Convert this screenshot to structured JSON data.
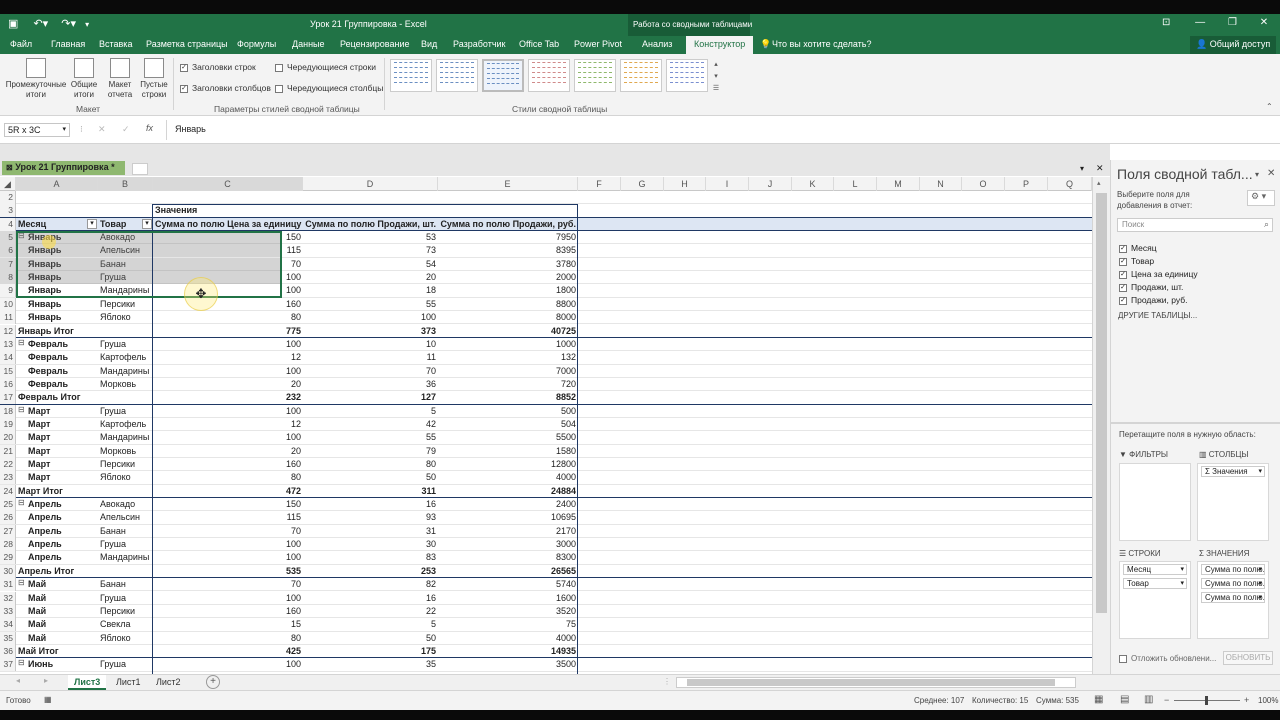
{
  "window": {
    "title": "Урок 21 Группировка - Excel",
    "context_tab": "Работа со сводными таблицами"
  },
  "tabs": [
    "Файл",
    "Главная",
    "Вставка",
    "Разметка страницы",
    "Формулы",
    "Данные",
    "Рецензирование",
    "Вид",
    "Разработчик",
    "Office Tab",
    "Power Pivot",
    "Анализ",
    "Конструктор"
  ],
  "tell_me": "Что вы хотите сделать?",
  "share": "Общий доступ",
  "ribbon": {
    "layout_buttons": [
      "Промежуточные\nитоги",
      "Общие\nитоги",
      "Макет\nотчета",
      "Пустые\nстроки"
    ],
    "layout_label": "Макет",
    "options": [
      {
        "label": "Заголовки строк",
        "checked": true
      },
      {
        "label": "Чередующиеся строки",
        "checked": false
      },
      {
        "label": "Заголовки столбцов",
        "checked": true
      },
      {
        "label": "Чередующиеся столбцы",
        "checked": false
      }
    ],
    "options_label": "Параметры стилей сводной таблицы",
    "styles_label": "Стили сводной таблицы"
  },
  "formula_bar": {
    "name_box": "5R x 3C",
    "fx": "fx",
    "value": "Январь"
  },
  "workbook_tab": "Урок 21 Группировка *",
  "columns": [
    "A",
    "B",
    "C",
    "D",
    "E",
    "F",
    "G",
    "H",
    "I",
    "J",
    "K",
    "L",
    "M",
    "N",
    "O",
    "P",
    "Q"
  ],
  "pivot": {
    "values_label": "Значения",
    "headers": [
      "Месяц",
      "Товар",
      "Сумма по полю Цена за единицу",
      "Сумма по полю Продажи, шт.",
      "Сумма по полю Продажи, руб."
    ],
    "rows": [
      {
        "n": "2",
        "a": "",
        "b": "",
        "c": "",
        "d": "",
        "e": "",
        "t": "blank"
      },
      {
        "n": "3",
        "a": "",
        "b": "",
        "c": "",
        "d": "",
        "e": "",
        "t": "values"
      },
      {
        "n": "4",
        "a": "",
        "b": "",
        "c": "",
        "d": "",
        "e": "",
        "t": "header"
      },
      {
        "n": "5",
        "a": "Январь",
        "b": "Авокадо",
        "c": "150",
        "d": "53",
        "e": "7950",
        "t": "first"
      },
      {
        "n": "6",
        "a": "Январь",
        "b": "Апельсин",
        "c": "115",
        "d": "73",
        "e": "8395",
        "t": "item"
      },
      {
        "n": "7",
        "a": "Январь",
        "b": "Банан",
        "c": "70",
        "d": "54",
        "e": "3780",
        "t": "item"
      },
      {
        "n": "8",
        "a": "Январь",
        "b": "Груша",
        "c": "100",
        "d": "20",
        "e": "2000",
        "t": "item"
      },
      {
        "n": "9",
        "a": "Январь",
        "b": "Мандарины",
        "c": "100",
        "d": "18",
        "e": "1800",
        "t": "item"
      },
      {
        "n": "10",
        "a": "Январь",
        "b": "Персики",
        "c": "160",
        "d": "55",
        "e": "8800",
        "t": "item"
      },
      {
        "n": "11",
        "a": "Январь",
        "b": "Яблоко",
        "c": "80",
        "d": "100",
        "e": "8000",
        "t": "item"
      },
      {
        "n": "12",
        "a": "Январь Итог",
        "b": "",
        "c": "775",
        "d": "373",
        "e": "40725",
        "t": "total"
      },
      {
        "n": "13",
        "a": "Февраль",
        "b": "Груша",
        "c": "100",
        "d": "10",
        "e": "1000",
        "t": "first"
      },
      {
        "n": "14",
        "a": "Февраль",
        "b": "Картофель",
        "c": "12",
        "d": "11",
        "e": "132",
        "t": "item"
      },
      {
        "n": "15",
        "a": "Февраль",
        "b": "Мандарины",
        "c": "100",
        "d": "70",
        "e": "7000",
        "t": "item"
      },
      {
        "n": "16",
        "a": "Февраль",
        "b": "Морковь",
        "c": "20",
        "d": "36",
        "e": "720",
        "t": "item"
      },
      {
        "n": "17",
        "a": "Февраль Итог",
        "b": "",
        "c": "232",
        "d": "127",
        "e": "8852",
        "t": "total"
      },
      {
        "n": "18",
        "a": "Март",
        "b": "Груша",
        "c": "100",
        "d": "5",
        "e": "500",
        "t": "first"
      },
      {
        "n": "19",
        "a": "Март",
        "b": "Картофель",
        "c": "12",
        "d": "42",
        "e": "504",
        "t": "item"
      },
      {
        "n": "20",
        "a": "Март",
        "b": "Мандарины",
        "c": "100",
        "d": "55",
        "e": "5500",
        "t": "item"
      },
      {
        "n": "21",
        "a": "Март",
        "b": "Морковь",
        "c": "20",
        "d": "79",
        "e": "1580",
        "t": "item"
      },
      {
        "n": "22",
        "a": "Март",
        "b": "Персики",
        "c": "160",
        "d": "80",
        "e": "12800",
        "t": "item"
      },
      {
        "n": "23",
        "a": "Март",
        "b": "Яблоко",
        "c": "80",
        "d": "50",
        "e": "4000",
        "t": "item"
      },
      {
        "n": "24",
        "a": "Март Итог",
        "b": "",
        "c": "472",
        "d": "311",
        "e": "24884",
        "t": "total"
      },
      {
        "n": "25",
        "a": "Апрель",
        "b": "Авокадо",
        "c": "150",
        "d": "16",
        "e": "2400",
        "t": "first"
      },
      {
        "n": "26",
        "a": "Апрель",
        "b": "Апельсин",
        "c": "115",
        "d": "93",
        "e": "10695",
        "t": "item"
      },
      {
        "n": "27",
        "a": "Апрель",
        "b": "Банан",
        "c": "70",
        "d": "31",
        "e": "2170",
        "t": "item"
      },
      {
        "n": "28",
        "a": "Апрель",
        "b": "Груша",
        "c": "100",
        "d": "30",
        "e": "3000",
        "t": "item"
      },
      {
        "n": "29",
        "a": "Апрель",
        "b": "Мандарины",
        "c": "100",
        "d": "83",
        "e": "8300",
        "t": "item"
      },
      {
        "n": "30",
        "a": "Апрель Итог",
        "b": "",
        "c": "535",
        "d": "253",
        "e": "26565",
        "t": "total"
      },
      {
        "n": "31",
        "a": "Май",
        "b": "Банан",
        "c": "70",
        "d": "82",
        "e": "5740",
        "t": "first"
      },
      {
        "n": "32",
        "a": "Май",
        "b": "Груша",
        "c": "100",
        "d": "16",
        "e": "1600",
        "t": "item"
      },
      {
        "n": "33",
        "a": "Май",
        "b": "Персики",
        "c": "160",
        "d": "22",
        "e": "3520",
        "t": "item"
      },
      {
        "n": "34",
        "a": "Май",
        "b": "Свекла",
        "c": "15",
        "d": "5",
        "e": "75",
        "t": "item"
      },
      {
        "n": "35",
        "a": "Май",
        "b": "Яблоко",
        "c": "80",
        "d": "50",
        "e": "4000",
        "t": "item"
      },
      {
        "n": "36",
        "a": "Май Итог",
        "b": "",
        "c": "425",
        "d": "175",
        "e": "14935",
        "t": "total"
      },
      {
        "n": "37",
        "a": "Июнь",
        "b": "Груша",
        "c": "100",
        "d": "35",
        "e": "3500",
        "t": "first"
      }
    ]
  },
  "field_pane": {
    "title": "Поля сводной табл...",
    "subtitle": "Выберите поля для добавления в отчет:",
    "search_placeholder": "Поиск",
    "fields": [
      {
        "label": "Месяц",
        "checked": true
      },
      {
        "label": "Товар",
        "checked": true
      },
      {
        "label": "Цена за единицу",
        "checked": true
      },
      {
        "label": "Продажи, шт.",
        "checked": true
      },
      {
        "label": "Продажи, руб.",
        "checked": true
      }
    ],
    "other_tables": "ДРУГИЕ ТАБЛИЦЫ...",
    "drag_hint": "Перетащите поля в нужную область:",
    "filters": "ФИЛЬТРЫ",
    "columns": "СТОЛБЦЫ",
    "columns_items": [
      "Σ Значения"
    ],
    "rows": "СТРОКИ",
    "rows_items": [
      "Месяц",
      "Товар"
    ],
    "values": "Σ ЗНАЧЕНИЯ",
    "values_items": [
      "Сумма по полю...",
      "Сумма по полю...",
      "Сумма по полю..."
    ],
    "defer": "Отложить обновлени...",
    "update": "ОБНОВИТЬ"
  },
  "sheets": [
    {
      "name": "Лист3",
      "active": true
    },
    {
      "name": "Лист1",
      "active": false
    },
    {
      "name": "Лист2",
      "active": false
    }
  ],
  "status": {
    "ready": "Готово",
    "average": "Среднее: 107",
    "count": "Количество: 15",
    "sum": "Сумма: 535",
    "zoom": "100%"
  },
  "colors": {
    "excel_green": "#217346",
    "selection": "#c9c9c9",
    "pivot_border": "#1f3864"
  }
}
